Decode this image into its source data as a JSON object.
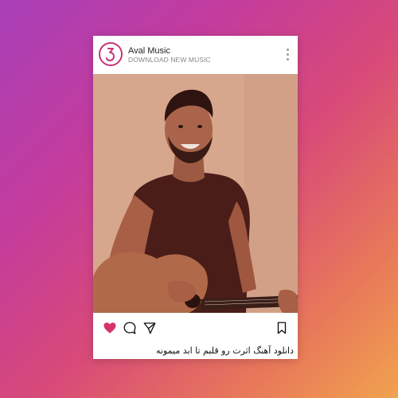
{
  "post": {
    "account_name": "Aval Music",
    "account_tagline": "DOWNLOAD NEW MUSIC",
    "caption": "دانلود آهنگ اثرت رو قلبم تا ابد میمونه"
  },
  "icons": {
    "logo": "music-note-icon",
    "more": "vertical-dots-icon",
    "like": "heart-icon",
    "comment": "comment-bubble-icon",
    "share": "send-paper-plane-icon",
    "save": "bookmark-icon"
  },
  "colors": {
    "accent": "#c8327a",
    "like": "#d6336c"
  }
}
